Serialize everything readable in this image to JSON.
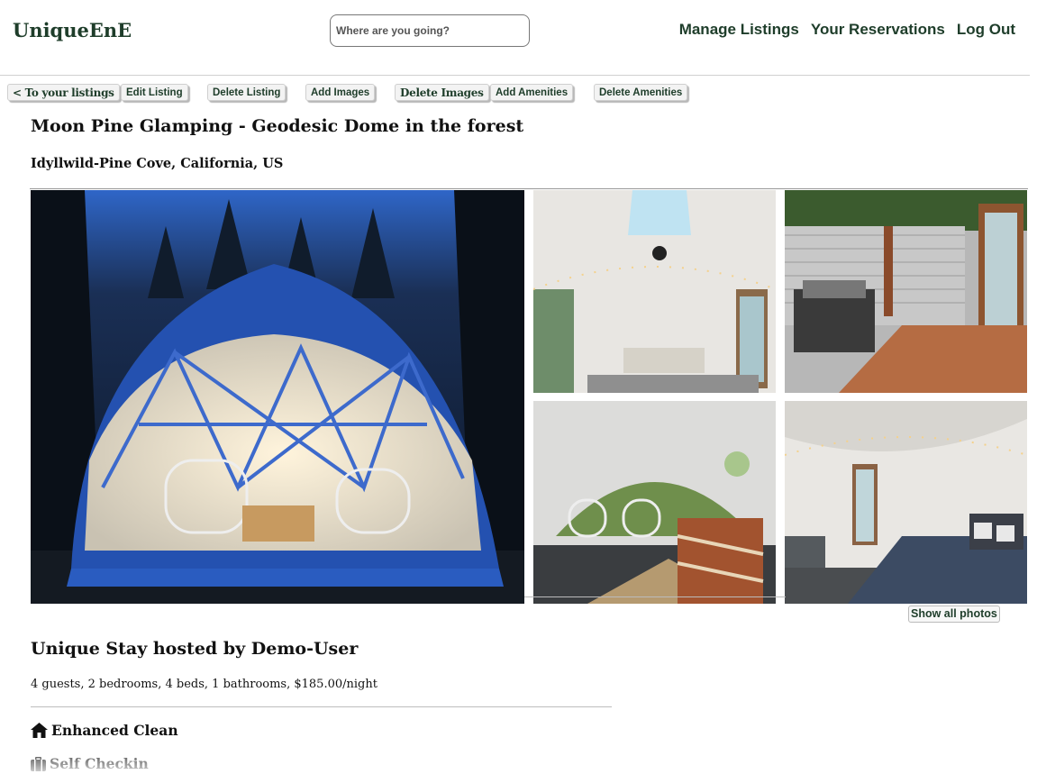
{
  "header": {
    "logo": "UniqueEnE",
    "search_placeholder": "Where are you going?",
    "nav": [
      "Manage Listings",
      "Your Reservations",
      "Log Out"
    ]
  },
  "toolbar": {
    "back_label": "< To your listings",
    "edit_label": "Edit Listing",
    "delete_listing_label": "Delete Listing",
    "add_images_label": "Add Images",
    "delete_images_label": "Delete Images",
    "add_amenities_label": "Add Amenities",
    "delete_amenities_label": "Delete Amenities"
  },
  "listing": {
    "title": "Moon Pine Glamping - Geodesic Dome in the forest",
    "location": "Idyllwild-Pine Cove, California, US",
    "show_all_photos": "Show all photos",
    "host_heading": "Unique Stay hosted by Demo-User",
    "details": "4 guests, 2 bedrooms, 4 beds, 1 bathrooms, $185.00/night"
  },
  "amenities": [
    {
      "icon": "home-icon",
      "label": "Enhanced Clean"
    },
    {
      "icon": "suitcase-icon",
      "label": "Self Checkin"
    }
  ],
  "colors": {
    "brand": "#1e3d2a",
    "dome_blue": "#2451b0"
  }
}
